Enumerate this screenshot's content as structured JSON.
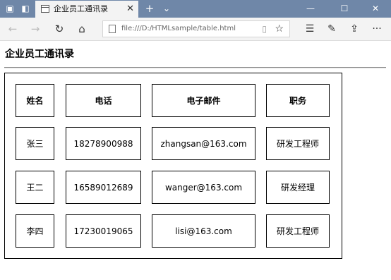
{
  "browser": {
    "tab_title": "企业员工通讯录",
    "address_url": "file:///D:/HTMLsample/table.html",
    "new_tab_symbol": "+",
    "tab_close_symbol": "✕",
    "tab_menu_symbol": "⌄",
    "minimize_symbol": "—",
    "maximize_symbol": "☐",
    "close_symbol": "✕",
    "back_symbol": "←",
    "forward_symbol": "→",
    "refresh_symbol": "↻",
    "home_symbol": "⌂",
    "reader_symbol": "▯",
    "favorite_symbol": "☆",
    "favorites_hub_symbol": "☰",
    "notes_symbol": "✎",
    "share_symbol": "⇪",
    "more_symbol": "···"
  },
  "page": {
    "heading": "企业员工通讯录",
    "table": {
      "headers": [
        "姓名",
        "电话",
        "电子邮件",
        "职务"
      ],
      "rows": [
        [
          "张三",
          "18278900988",
          "zhangsan@163.com",
          "研发工程师"
        ],
        [
          "王二",
          "16589012689",
          "wanger@163.com",
          "研发经理"
        ],
        [
          "李四",
          "17230019065",
          "lisi@163.com",
          "研发工程师"
        ]
      ]
    }
  }
}
